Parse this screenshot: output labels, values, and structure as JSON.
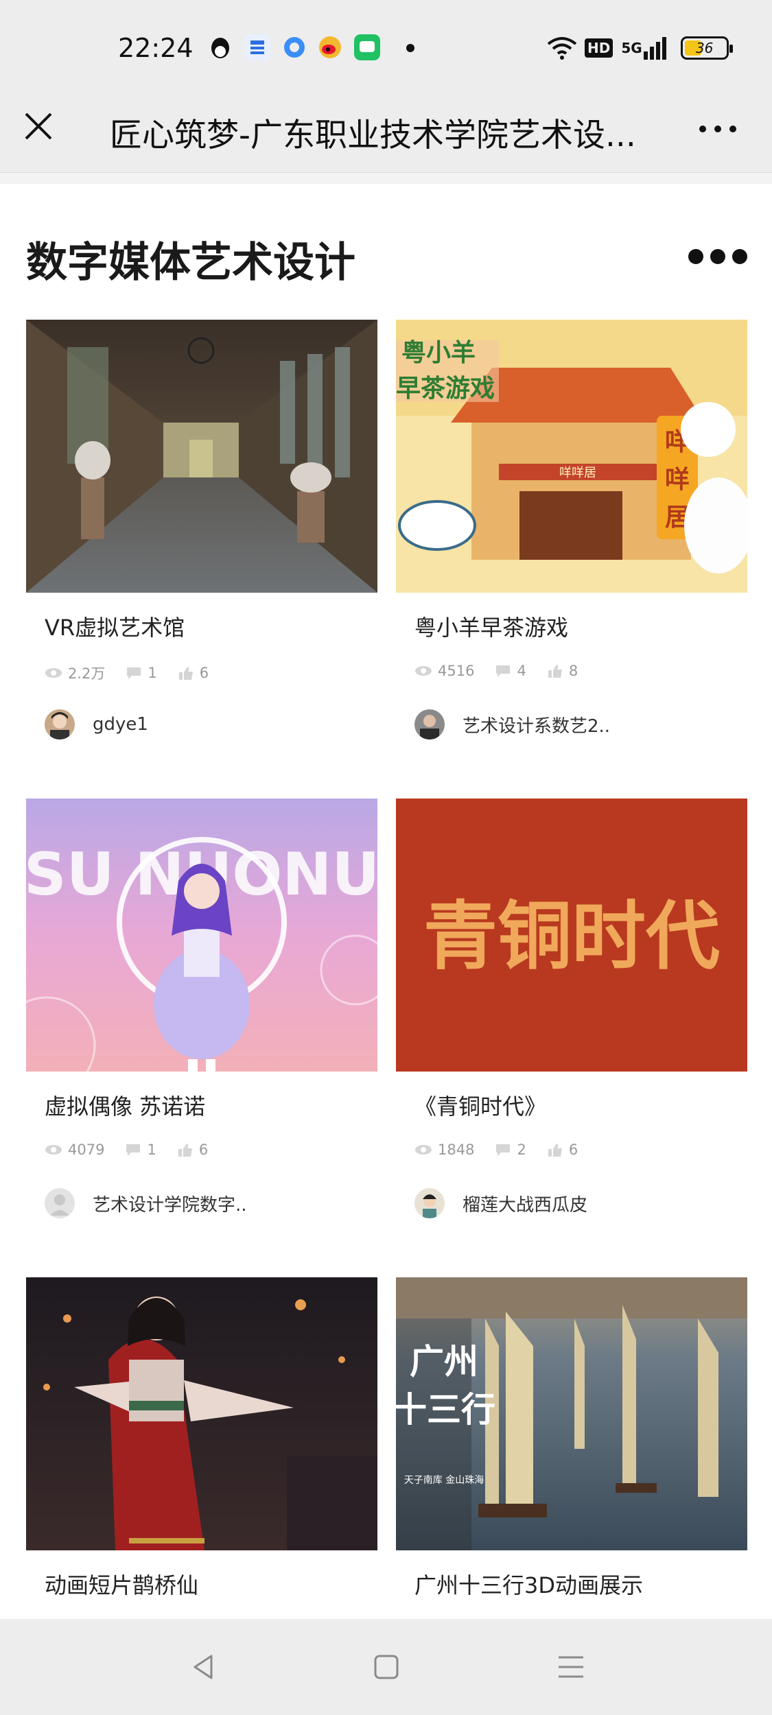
{
  "status_bar": {
    "time": "22:24",
    "app_icons": [
      "qq-penguin-icon",
      "app-blue-icon",
      "browser-icon",
      "weibo-icon",
      "wechat-work-icon"
    ],
    "hd_label": "HD",
    "network_label": "5G",
    "battery": "36"
  },
  "nav": {
    "title": "匠心筑梦-广东职业技术学院艺术设..."
  },
  "section": {
    "title": "数字媒体艺术设计"
  },
  "cards": [
    {
      "title": "VR虚拟艺术馆",
      "views": "2.2万",
      "comments": "1",
      "likes": "6",
      "author": "gdye1"
    },
    {
      "title": "粤小羊早茶游戏",
      "views": "4516",
      "comments": "4",
      "likes": "8",
      "author": "艺术设计系数艺2..",
      "thumb_text_a": "粤小羊",
      "thumb_text_b": "早茶游戏",
      "thumb_sign": "咩咩居",
      "thumb_vert": "咩咩居"
    },
    {
      "title": "虚拟偶像 苏诺诺",
      "views": "4079",
      "comments": "1",
      "likes": "6",
      "author": "艺术设计学院数字..",
      "thumb_text": "SU NUONU"
    },
    {
      "title": "《青铜时代》",
      "views": "1848",
      "comments": "2",
      "likes": "6",
      "author": "榴莲大战西瓜皮",
      "thumb_text": "青铜时代"
    },
    {
      "title": "动画短片鹊桥仙"
    },
    {
      "title": "广州十三行3D动画展示",
      "thumb_text_a": "广州",
      "thumb_text_b": "十三行",
      "thumb_small": "天子南库 金山珠海"
    }
  ],
  "colors": {
    "bronze_bg": "#b8391f",
    "bronze_text": "#f0a85a",
    "accent_green": "#07c160"
  }
}
